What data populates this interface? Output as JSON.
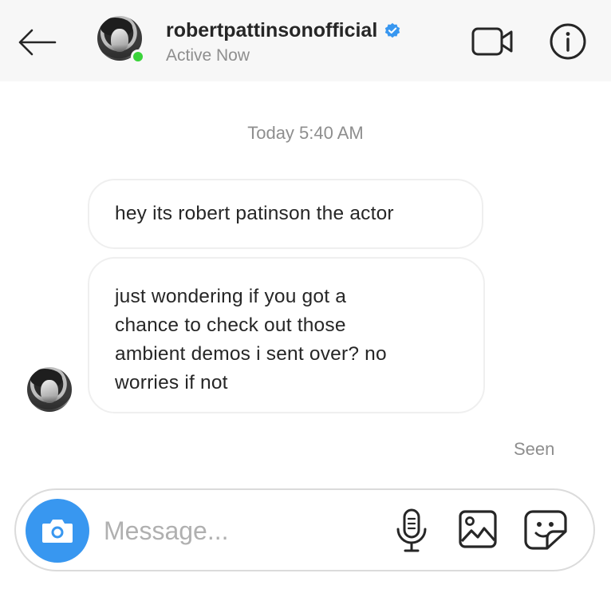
{
  "header": {
    "username": "robertpattinsonofficial",
    "status": "Active Now",
    "icons": {
      "back": "back-arrow-icon",
      "verified": "verified-badge-icon",
      "video": "video-camera-icon",
      "info": "info-icon"
    }
  },
  "thread": {
    "timestamp": "Today 5:40 AM",
    "messages": [
      {
        "lines": [
          "hey its robert patinson the actor"
        ]
      },
      {
        "lines": [
          "just wondering if you got a",
          "chance to check out those",
          "ambient demos i sent over? no",
          "worries if not"
        ]
      }
    ],
    "seen_label": "Seen"
  },
  "composer": {
    "placeholder": "Message...",
    "value": "",
    "icons": {
      "camera": "camera-icon",
      "mic": "microphone-icon",
      "gallery": "gallery-icon",
      "sticker": "sticker-icon"
    }
  },
  "colors": {
    "header_bg": "#f7f7f7",
    "accent_blue": "#3897f0",
    "online_green": "#3ad33a",
    "secondary_text": "#8e8e8e"
  }
}
